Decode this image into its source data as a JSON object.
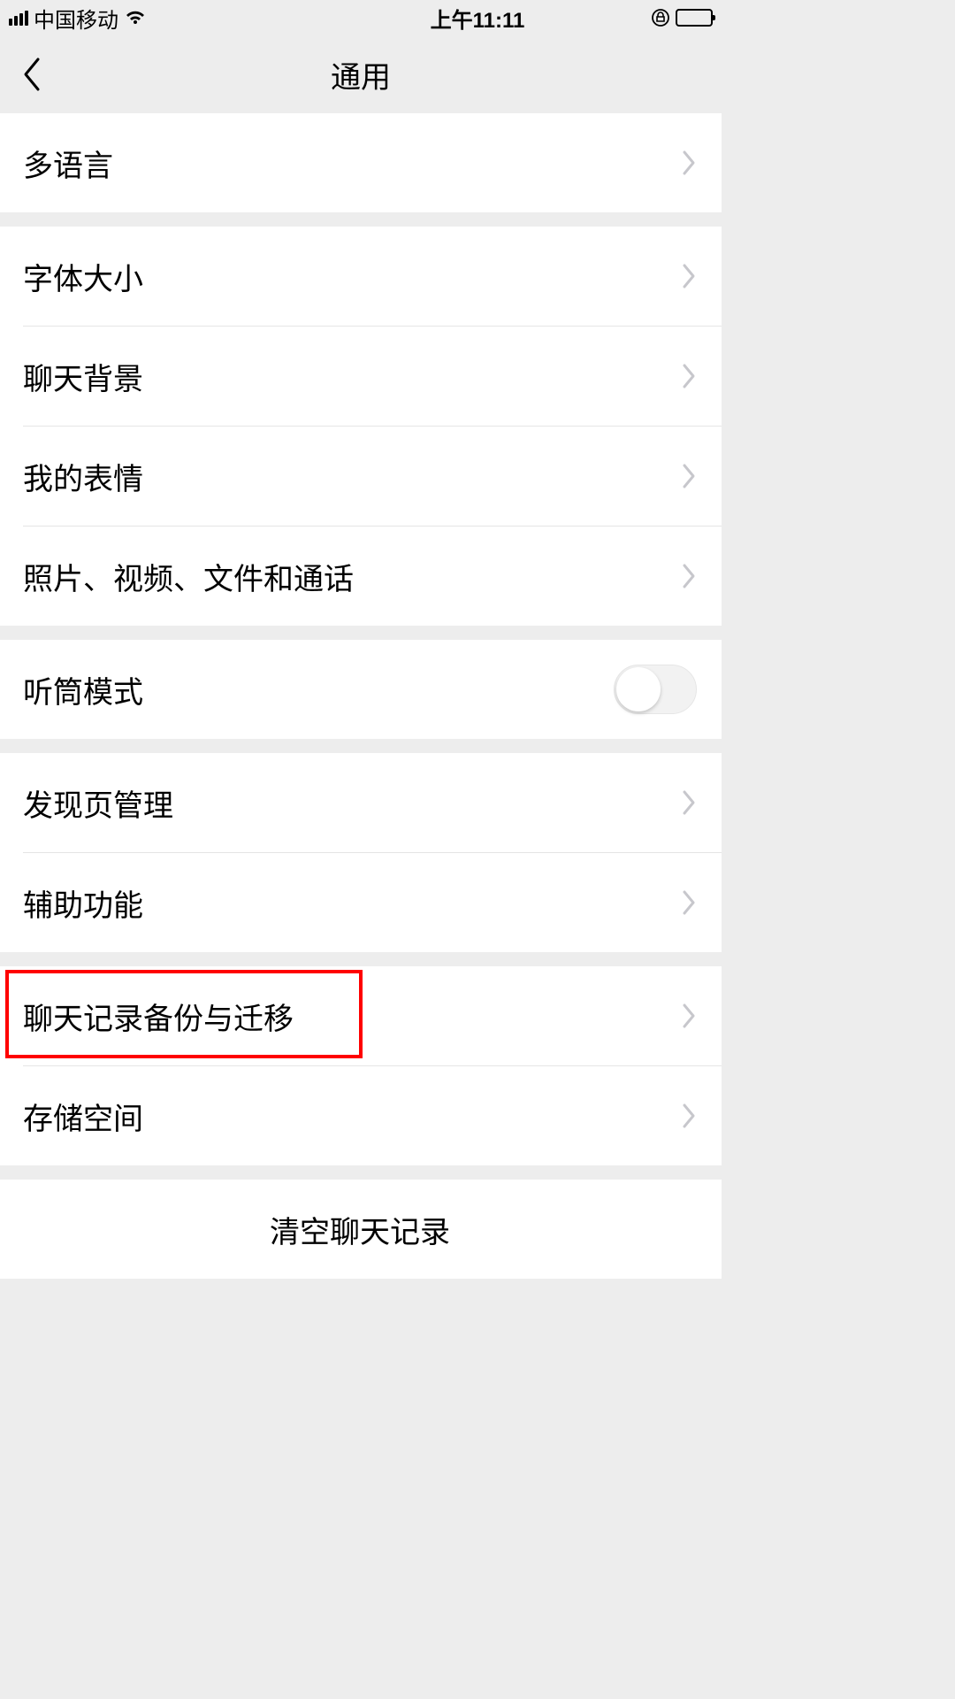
{
  "status": {
    "carrier": "中国移动",
    "time": "上午11:11"
  },
  "nav": {
    "title": "通用"
  },
  "groups": [
    {
      "rows": [
        {
          "id": "language",
          "label": "多语言",
          "accessory": "chevron"
        }
      ]
    },
    {
      "rows": [
        {
          "id": "font-size",
          "label": "字体大小",
          "accessory": "chevron"
        },
        {
          "id": "chat-background",
          "label": "聊天背景",
          "accessory": "chevron"
        },
        {
          "id": "my-stickers",
          "label": "我的表情",
          "accessory": "chevron"
        },
        {
          "id": "media-files-calls",
          "label": "照片、视频、文件和通话",
          "accessory": "chevron"
        }
      ]
    },
    {
      "rows": [
        {
          "id": "earpiece-mode",
          "label": "听筒模式",
          "accessory": "toggle",
          "toggle_on": false
        }
      ]
    },
    {
      "rows": [
        {
          "id": "discover-manage",
          "label": "发现页管理",
          "accessory": "chevron"
        },
        {
          "id": "accessibility",
          "label": "辅助功能",
          "accessory": "chevron"
        }
      ]
    },
    {
      "rows": [
        {
          "id": "chat-backup-migrate",
          "label": "聊天记录备份与迁移",
          "accessory": "chevron",
          "highlighted": true
        },
        {
          "id": "storage",
          "label": "存储空间",
          "accessory": "chevron"
        }
      ]
    },
    {
      "rows": [
        {
          "id": "clear-chat-history",
          "label": "清空聊天记录",
          "accessory": "none",
          "center": true
        }
      ]
    }
  ]
}
